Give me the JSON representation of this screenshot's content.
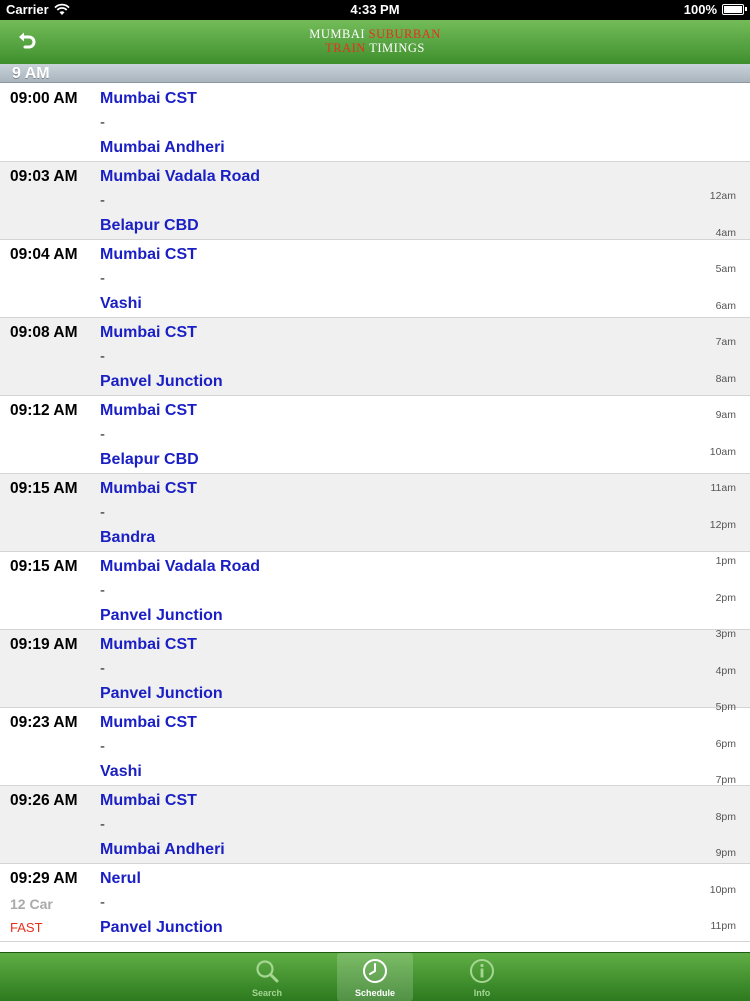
{
  "status_bar": {
    "carrier": "Carrier",
    "time": "4:33 PM",
    "battery": "100%"
  },
  "nav": {
    "title_line1_white": "Mumbai",
    "title_line1_red": "Suburban",
    "title_line2_red": "Train",
    "title_line2_white": "Timings"
  },
  "section": {
    "header": "9 AM"
  },
  "trains": [
    {
      "time": "09:00 AM",
      "from": "Mumbai CST",
      "dash": "-",
      "to": "Mumbai Andheri",
      "cars": "",
      "tag": ""
    },
    {
      "time": "09:03 AM",
      "from": "Mumbai Vadala Road",
      "dash": "-",
      "to": "Belapur CBD",
      "cars": "",
      "tag": ""
    },
    {
      "time": "09:04 AM",
      "from": "Mumbai CST",
      "dash": "-",
      "to": "Vashi",
      "cars": "",
      "tag": ""
    },
    {
      "time": "09:08 AM",
      "from": "Mumbai CST",
      "dash": "-",
      "to": "Panvel Junction",
      "cars": "",
      "tag": ""
    },
    {
      "time": "09:12 AM",
      "from": "Mumbai CST",
      "dash": "-",
      "to": "Belapur CBD",
      "cars": "",
      "tag": ""
    },
    {
      "time": "09:15 AM",
      "from": "Mumbai CST",
      "dash": "-",
      "to": "Bandra",
      "cars": "",
      "tag": ""
    },
    {
      "time": "09:15 AM",
      "from": "Mumbai Vadala Road",
      "dash": "-",
      "to": "Panvel Junction",
      "cars": "",
      "tag": ""
    },
    {
      "time": "09:19 AM",
      "from": "Mumbai CST",
      "dash": "-",
      "to": "Panvel Junction",
      "cars": "",
      "tag": ""
    },
    {
      "time": "09:23 AM",
      "from": "Mumbai CST",
      "dash": "-",
      "to": "Vashi",
      "cars": "",
      "tag": ""
    },
    {
      "time": "09:26 AM",
      "from": "Mumbai CST",
      "dash": "-",
      "to": "Mumbai Andheri",
      "cars": "",
      "tag": ""
    },
    {
      "time": "09:29 AM",
      "from": "Nerul",
      "dash": "-",
      "to": "Panvel Junction",
      "cars": "12 Car",
      "tag": "FAST"
    }
  ],
  "hour_index": [
    "12am",
    "4am",
    "5am",
    "6am",
    "7am",
    "8am",
    "9am",
    "10am",
    "11am",
    "12pm",
    "1pm",
    "2pm",
    "3pm",
    "4pm",
    "5pm",
    "6pm",
    "7pm",
    "8pm",
    "9pm",
    "10pm",
    "11pm"
  ],
  "tabs": [
    {
      "label": "Search",
      "icon": "search-icon",
      "active": false
    },
    {
      "label": "Schedule",
      "icon": "clock-icon",
      "active": true
    },
    {
      "label": "Info",
      "icon": "info-icon",
      "active": false
    }
  ],
  "colors": {
    "nav_green": "#4f9e3a",
    "link_blue": "#1a1fc4",
    "fast_red": "#e8301c"
  }
}
